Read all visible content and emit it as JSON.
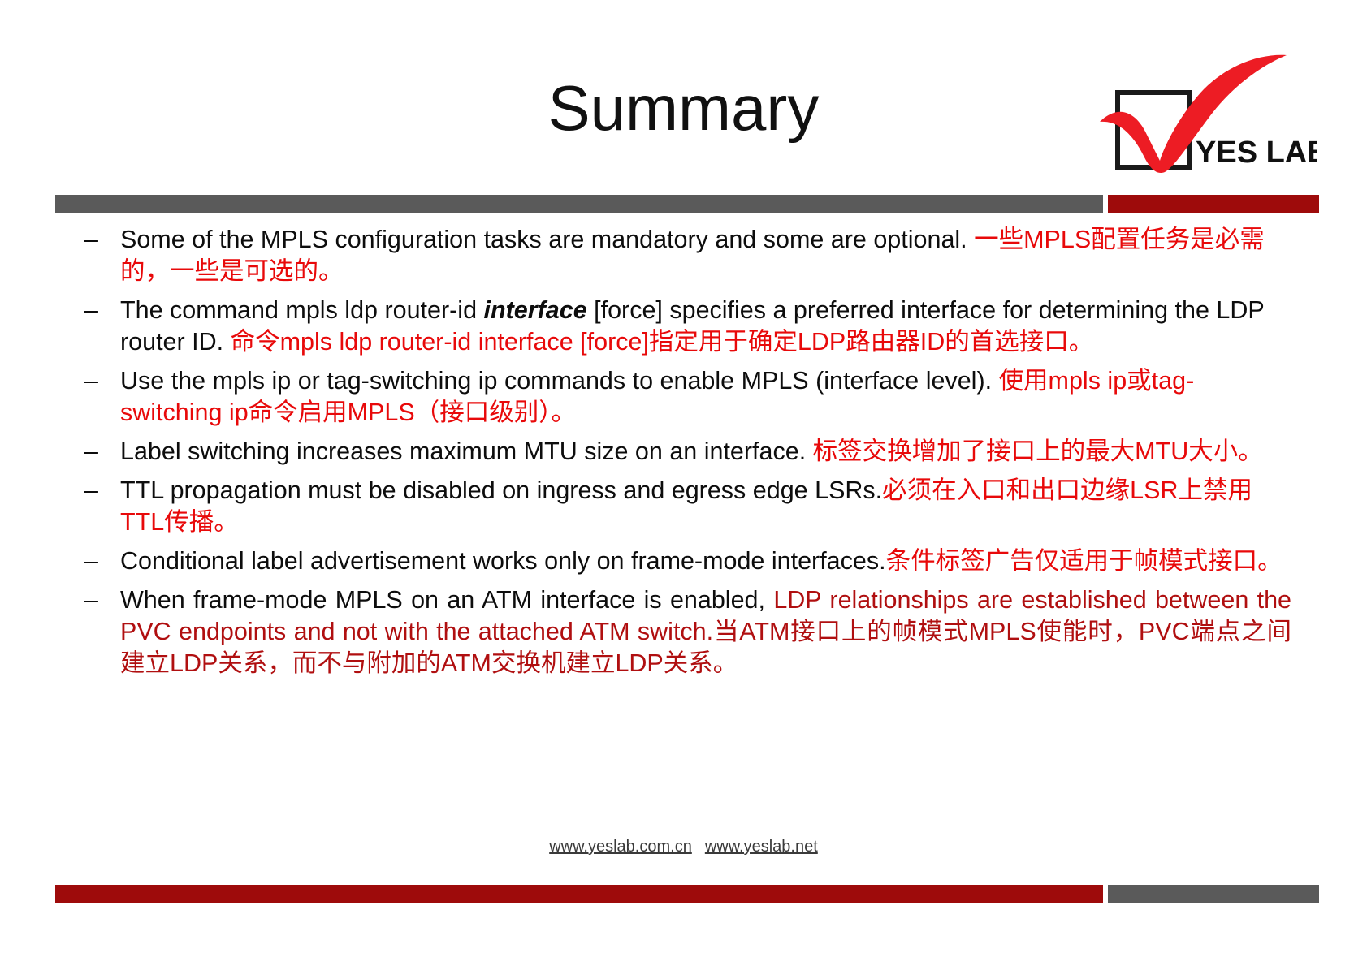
{
  "slide": {
    "title": "Summary",
    "logo": {
      "name": "yes-lab-logo",
      "text": "YES LAB",
      "check_color": "#ED1C24",
      "box_color": "#1a1a1a"
    },
    "colors": {
      "accent_red": "#9e0b0b",
      "accent_grey": "#5a5a5a",
      "text_red": "#e8090a",
      "text_dark_red": "#b00f10",
      "text_black": "#0d0d0d"
    },
    "bullet_marker": "–"
  },
  "bullets": [
    {
      "id": "bullet-mandatory-optional",
      "segments": [
        {
          "text": "Some of the MPLS configuration tasks are mandatory and some  are optional.  ",
          "color": "black",
          "style": "normal"
        },
        {
          "text": "一些MPLS配置任务是必需的，一些是可选的。",
          "color": "red",
          "style": "normal"
        }
      ]
    },
    {
      "id": "bullet-router-id",
      "segments": [
        {
          "text": "The command ",
          "color": "black",
          "style": "normal"
        },
        {
          "text": "mpls ldp router-id ",
          "color": "black",
          "style": "normal"
        },
        {
          "text": "interface",
          "color": "black",
          "style": "italic"
        },
        {
          "text": "  [force] ",
          "color": "black",
          "style": "normal"
        },
        {
          "text": "specifies a preferred  interface for determining  the LDP router ID.   ",
          "color": "black",
          "style": "normal"
        },
        {
          "text": "命令mpls ldp router-id interface [force]指定用于确定LDP路由器ID的首选接口。",
          "color": "red",
          "style": "normal"
        }
      ]
    },
    {
      "id": "bullet-enable-mpls",
      "segments": [
        {
          "text": "Use the ",
          "color": "black",
          "style": "normal"
        },
        {
          "text": "mpls ip ",
          "color": "black",
          "style": "normal"
        },
        {
          "text": "or ",
          "color": "black",
          "style": "normal"
        },
        {
          "text": "tag-switching ip ",
          "color": "black",
          "style": "normal"
        },
        {
          "text": "commands to enable  MPLS (interface  level).  ",
          "color": "black",
          "style": "normal"
        },
        {
          "text": "使用mpls ip或tag-switching ip命令启用MPLS（接口级别）。",
          "color": "red",
          "style": "normal"
        }
      ]
    },
    {
      "id": "bullet-mtu",
      "segments": [
        {
          "text": "Label switching increases maximum MTU size on an interface.  ",
          "color": "black",
          "style": "normal"
        },
        {
          "text": "标签交换增加了接口上的最大MTU大小。",
          "color": "red",
          "style": "normal"
        }
      ]
    },
    {
      "id": "bullet-ttl",
      "segments": [
        {
          "text": "TTL propagation must be disabled  on ingress and egress  edge LSRs.",
          "color": "black",
          "style": "normal"
        },
        {
          "text": "必须在入口和出口边缘LSR上禁用TTL传播。",
          "color": "red",
          "style": "normal"
        }
      ]
    },
    {
      "id": "bullet-conditional-label",
      "segments": [
        {
          "text": "Conditional  label advertisement works only on frame-mode  interfaces.",
          "color": "black",
          "style": "normal"
        },
        {
          "text": "条件标签广告仅适用于帧模式接口。",
          "color": "red",
          "style": "normal"
        }
      ]
    },
    {
      "id": "bullet-atm",
      "segments": [
        {
          "text": "When  frame-mode  MPLS  on  an  ATM  interface  is  enabled, ",
          "color": "black",
          "style": "normal"
        },
        {
          "text": "LDP  relationships   are established between the PVC endpoints and not with the attached ATM  switch.",
          "color": "darkred",
          "style": "normal"
        },
        {
          "text": "当ATM接口上的帧模式MPLS使能时，PVC端点之间建立LDP关系，而不与附加的ATM交换机建立LDP关系。",
          "color": "darkred",
          "style": "normal"
        }
      ]
    }
  ],
  "footer": {
    "link1": "www.yeslab.com.cn",
    "link2": "www.yeslab.net"
  }
}
